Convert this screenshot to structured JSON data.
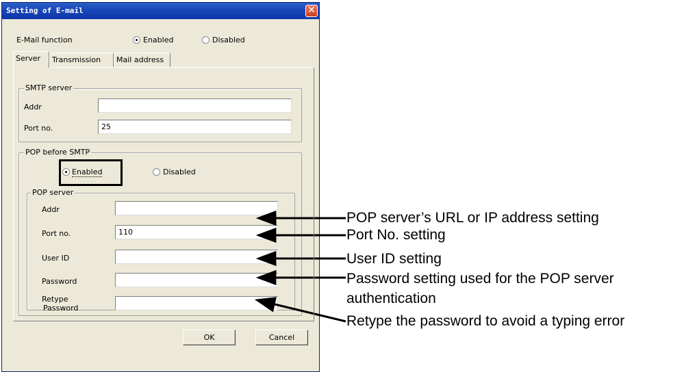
{
  "window": {
    "title": "Setting of E-mail",
    "close_glyph": "✕"
  },
  "email_function": {
    "label": "E-Mail function",
    "enabled": "Enabled",
    "disabled": "Disabled",
    "selected": "Enabled"
  },
  "tabs": [
    {
      "label": "Server",
      "active": true
    },
    {
      "label": "Transmission",
      "active": false
    },
    {
      "label": "Mail address",
      "active": false
    }
  ],
  "smtp": {
    "title": "SMTP server",
    "addr_label": "Addr",
    "addr_value": "",
    "port_label": "Port no.",
    "port_value": "25"
  },
  "pop_before_smtp": {
    "title": "POP before SMTP",
    "enabled": "Enabled",
    "disabled": "Disabled",
    "selected": "Enabled"
  },
  "pop_server": {
    "title": "POP server",
    "addr_label": "Addr",
    "addr_value": "",
    "port_label": "Port no.",
    "port_value": "110",
    "userid_label": "User ID",
    "userid_value": "",
    "password_label": "Password",
    "password_value": "",
    "retype_label_1": "Retype",
    "retype_label_2": "Password",
    "retype_value": ""
  },
  "buttons": {
    "ok": "OK",
    "cancel": "Cancel"
  },
  "annotations": {
    "addr": "POP server’s URL or IP address setting",
    "port": "Port No. setting",
    "userid": "User ID setting",
    "password_1": "Password setting used for the POP server",
    "password_2": "authentication",
    "retype": "Retype the password to avoid a typing error"
  }
}
